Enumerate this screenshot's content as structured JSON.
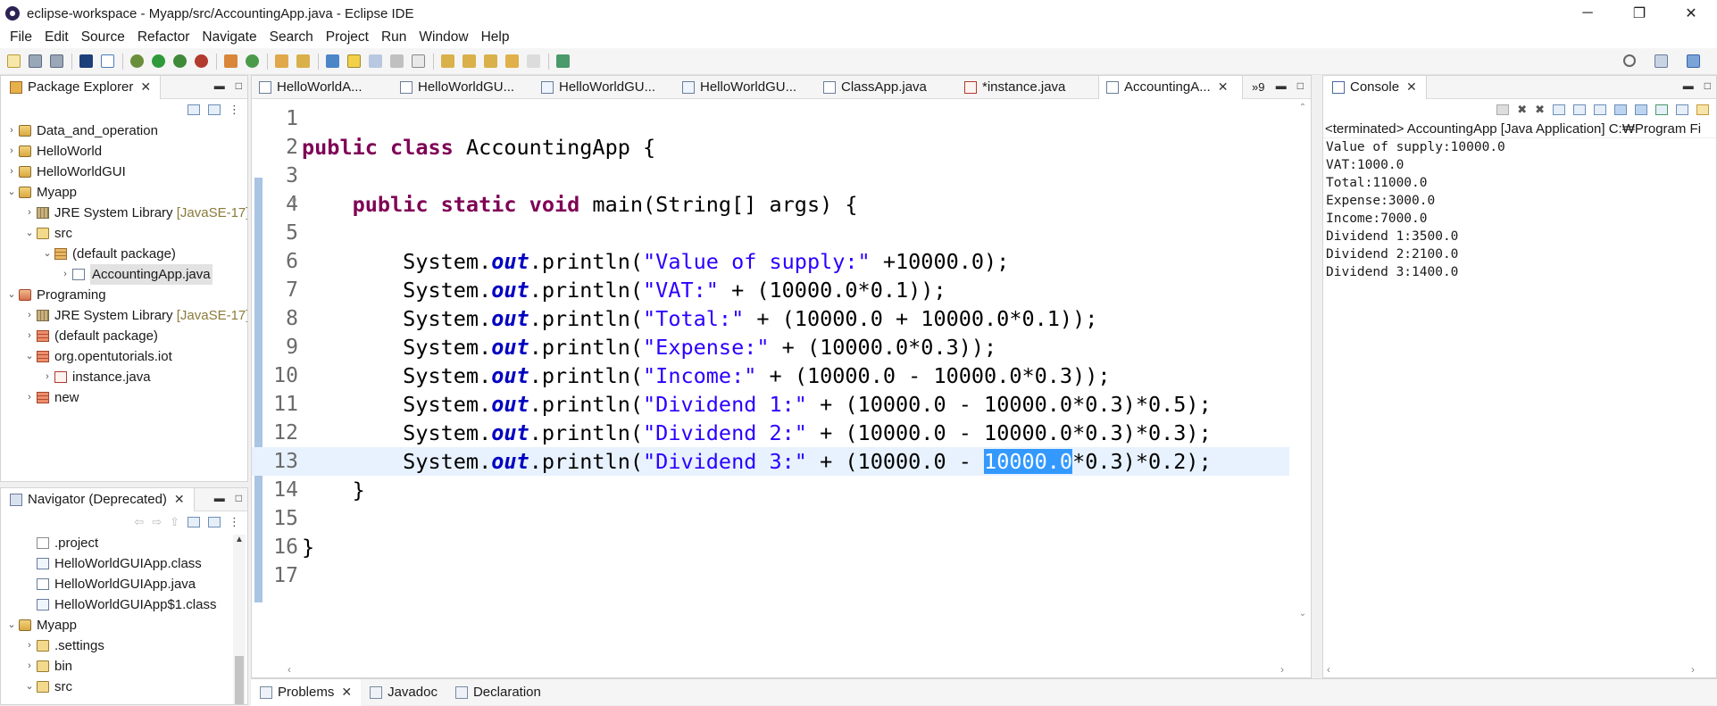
{
  "window": {
    "title": "eclipse-workspace - Myapp/src/AccountingApp.java - Eclipse IDE",
    "minimize": "─",
    "restore": "❐",
    "close": "✕"
  },
  "menu": [
    "File",
    "Edit",
    "Source",
    "Refactor",
    "Navigate",
    "Search",
    "Project",
    "Run",
    "Window",
    "Help"
  ],
  "package_explorer": {
    "title": "Package Explorer",
    "items": [
      {
        "label": "Data_and_operation",
        "indent": 0,
        "arrow": "›",
        "icon": "project"
      },
      {
        "label": "HelloWorld",
        "indent": 0,
        "arrow": "›",
        "icon": "project"
      },
      {
        "label": "HelloWorldGUI",
        "indent": 0,
        "arrow": "›",
        "icon": "project"
      },
      {
        "label": "Myapp",
        "indent": 0,
        "arrow": "⌄",
        "icon": "project"
      },
      {
        "label": "JRE System Library",
        "annotation": "[JavaSE-17]",
        "indent": 1,
        "arrow": "›",
        "icon": "lib"
      },
      {
        "label": "src",
        "indent": 1,
        "arrow": "⌄",
        "icon": "folder"
      },
      {
        "label": "(default package)",
        "indent": 2,
        "arrow": "⌄",
        "icon": "pkg"
      },
      {
        "label": "AccountingApp.java",
        "indent": 3,
        "arrow": "›",
        "icon": "java",
        "selected": true
      },
      {
        "label": "Programing",
        "indent": 0,
        "arrow": "⌄",
        "icon": "project-red"
      },
      {
        "label": "JRE System Library",
        "annotation": "[JavaSE-17]",
        "indent": 1,
        "arrow": "›",
        "icon": "lib"
      },
      {
        "label": "(default package)",
        "indent": 1,
        "arrow": "›",
        "icon": "pkg-red"
      },
      {
        "label": "org.opentutorials.iot",
        "indent": 1,
        "arrow": "⌄",
        "icon": "pkg-red"
      },
      {
        "label": "instance.java",
        "indent": 2,
        "arrow": "›",
        "icon": "java-red"
      },
      {
        "label": "new",
        "indent": 1,
        "arrow": "›",
        "icon": "pkg-red"
      }
    ]
  },
  "navigator": {
    "title": "Navigator (Deprecated)",
    "items": [
      {
        "label": ".project",
        "indent": 1,
        "arrow": "",
        "icon": "file"
      },
      {
        "label": "HelloWorldGUIApp.class",
        "indent": 1,
        "arrow": "",
        "icon": "class"
      },
      {
        "label": "HelloWorldGUIApp.java",
        "indent": 1,
        "arrow": "",
        "icon": "java"
      },
      {
        "label": "HelloWorldGUIApp$1.class",
        "indent": 1,
        "arrow": "",
        "icon": "class"
      },
      {
        "label": "Myapp",
        "indent": 0,
        "arrow": "⌄",
        "icon": "project"
      },
      {
        "label": ".settings",
        "indent": 1,
        "arrow": "›",
        "icon": "folder"
      },
      {
        "label": "bin",
        "indent": 1,
        "arrow": "›",
        "icon": "folder"
      },
      {
        "label": "src",
        "indent": 1,
        "arrow": "⌄",
        "icon": "folder"
      }
    ]
  },
  "editor": {
    "tabs": [
      {
        "label": "HelloWorldA...",
        "icon": "java",
        "active": false
      },
      {
        "label": "HelloWorldGU...",
        "icon": "java",
        "active": false
      },
      {
        "label": "HelloWorldGU...",
        "icon": "class",
        "active": false
      },
      {
        "label": "HelloWorldGU...",
        "icon": "class",
        "active": false
      },
      {
        "label": "ClassApp.java",
        "icon": "java",
        "active": false
      },
      {
        "label": "*instance.java",
        "icon": "java-red",
        "active": false
      },
      {
        "label": "AccountingA...",
        "icon": "java",
        "active": true
      }
    ],
    "overflow_label": "»9",
    "lines": [
      {
        "n": "1",
        "tokens": []
      },
      {
        "n": "2",
        "tokens": [
          [
            "kw",
            "public class "
          ],
          [
            "",
            "AccountingApp {"
          ]
        ]
      },
      {
        "n": "3",
        "tokens": []
      },
      {
        "n": "4",
        "fold": "⊖",
        "tokens": [
          [
            "",
            "    "
          ],
          [
            "kw",
            "public static void "
          ],
          [
            "",
            "main(String[] args) {"
          ]
        ]
      },
      {
        "n": "5",
        "tokens": []
      },
      {
        "n": "6",
        "tokens": [
          [
            "",
            "        System."
          ],
          [
            "fld",
            "out"
          ],
          [
            "",
            ".println("
          ],
          [
            "str",
            "\"Value of supply:\""
          ],
          [
            "",
            " +10000.0);"
          ]
        ]
      },
      {
        "n": "7",
        "tokens": [
          [
            "",
            "        System."
          ],
          [
            "fld",
            "out"
          ],
          [
            "",
            ".println("
          ],
          [
            "str",
            "\"VAT:\""
          ],
          [
            "",
            " + (10000.0*0.1));"
          ]
        ]
      },
      {
        "n": "8",
        "tokens": [
          [
            "",
            "        System."
          ],
          [
            "fld",
            "out"
          ],
          [
            "",
            ".println("
          ],
          [
            "str",
            "\"Total:\""
          ],
          [
            "",
            " + (10000.0 + 10000.0*0.1));"
          ]
        ]
      },
      {
        "n": "9",
        "tokens": [
          [
            "",
            "        System."
          ],
          [
            "fld",
            "out"
          ],
          [
            "",
            ".println("
          ],
          [
            "str",
            "\"Expense:\""
          ],
          [
            "",
            " + (10000.0*0.3));"
          ]
        ]
      },
      {
        "n": "10",
        "tokens": [
          [
            "",
            "        System."
          ],
          [
            "fld",
            "out"
          ],
          [
            "",
            ".println("
          ],
          [
            "str",
            "\"Income:\""
          ],
          [
            "",
            " + (10000.0 - 10000.0*0.3));"
          ]
        ]
      },
      {
        "n": "11",
        "tokens": [
          [
            "",
            "        System."
          ],
          [
            "fld",
            "out"
          ],
          [
            "",
            ".println("
          ],
          [
            "str",
            "\"Dividend 1:\""
          ],
          [
            "",
            " + (10000.0 - 10000.0*0.3)*0.5);"
          ]
        ]
      },
      {
        "n": "12",
        "tokens": [
          [
            "",
            "        System."
          ],
          [
            "fld",
            "out"
          ],
          [
            "",
            ".println("
          ],
          [
            "str",
            "\"Dividend 2:\""
          ],
          [
            "",
            " + (10000.0 - 10000.0*0.3)*0.3);"
          ]
        ]
      },
      {
        "n": "13",
        "current": true,
        "tokens": [
          [
            "",
            "        System."
          ],
          [
            "fld",
            "out"
          ],
          [
            "",
            ".println("
          ],
          [
            "str",
            "\"Dividend 3:\""
          ],
          [
            "",
            " + (10000.0 - "
          ],
          [
            "sel",
            "10000.0"
          ],
          [
            "",
            "*0.3)*0.2);"
          ]
        ]
      },
      {
        "n": "14",
        "tokens": [
          [
            "",
            "    }"
          ]
        ]
      },
      {
        "n": "15",
        "tokens": []
      },
      {
        "n": "16",
        "tokens": [
          [
            "",
            "}"
          ]
        ]
      },
      {
        "n": "17",
        "tokens": []
      }
    ]
  },
  "console": {
    "title": "Console",
    "header": "<terminated> AccountingApp [Java Application] C:₩Program Fi",
    "output": [
      "Value of supply:10000.0",
      "VAT:1000.0",
      "Total:11000.0",
      "Expense:3000.0",
      "Income:7000.0",
      "Dividend 1:3500.0",
      "Dividend 2:2100.0",
      "Dividend 3:1400.0"
    ]
  },
  "bottom_tabs": [
    {
      "label": "Problems",
      "closable": true,
      "active": true
    },
    {
      "label": "Javadoc",
      "closable": false,
      "active": false
    },
    {
      "label": "Declaration",
      "closable": false,
      "active": false
    }
  ],
  "colors": {
    "keyword": "#7f0055",
    "string": "#2a00ff",
    "field": "#0000c0",
    "selection": "#3399ff",
    "current_line": "#e8f2fe"
  }
}
